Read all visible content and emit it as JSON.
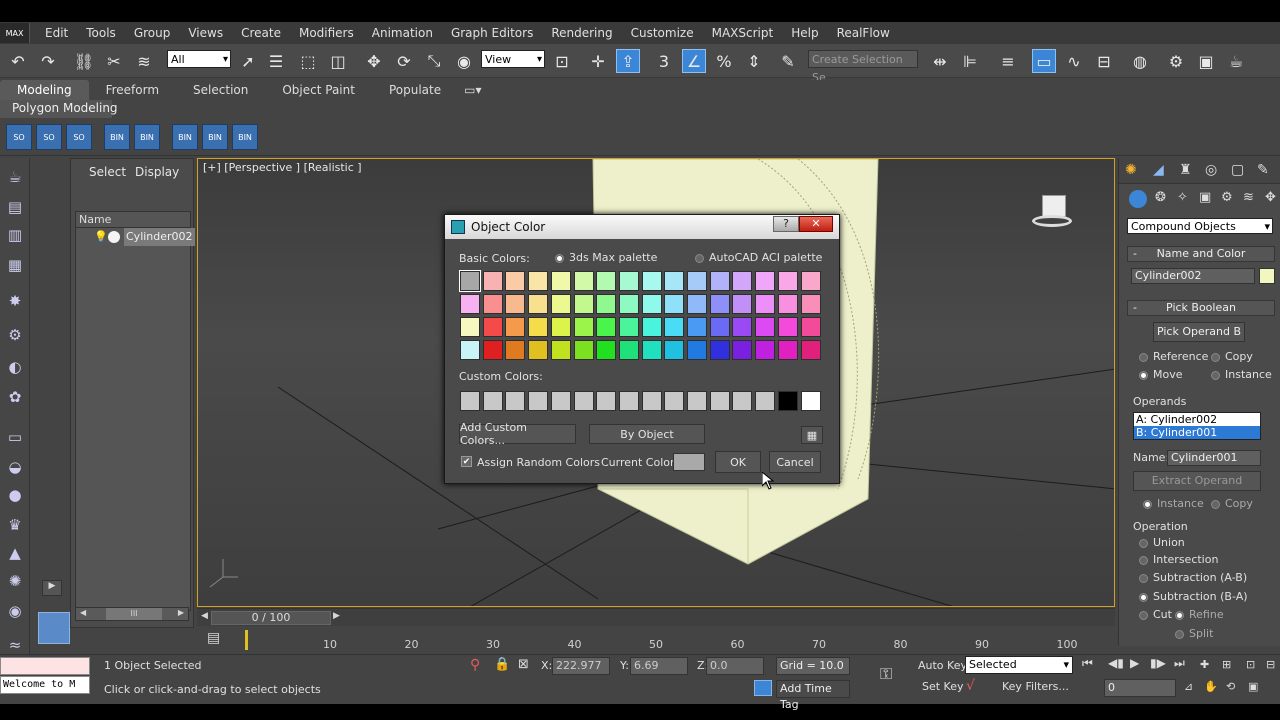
{
  "menubar": {
    "logo": "MAX",
    "items": [
      "Edit",
      "Tools",
      "Group",
      "Views",
      "Create",
      "Modifiers",
      "Animation",
      "Graph Editors",
      "Rendering",
      "Customize",
      "MAXScript",
      "Help",
      "RealFlow"
    ]
  },
  "toolbar": {
    "filter_select": "All",
    "refcoord_select": "View",
    "named_selection_placeholder": "Create Selection Se"
  },
  "ribbon": {
    "tabs": [
      "Modeling",
      "Freeform",
      "Selection",
      "Object Paint",
      "Populate"
    ],
    "active_tab": "Modeling",
    "panel_label": "Polygon Modeling"
  },
  "explorer": {
    "tabs": [
      "Select",
      "Display"
    ],
    "column_header": "Name",
    "rows": [
      "Cylinder002"
    ],
    "scroll_label": "III"
  },
  "viewport": {
    "label": "[+] [Perspective ] [Realistic ]"
  },
  "dialog": {
    "title": "Object Color",
    "help": "?",
    "close": "✕",
    "basic_colors_label": "Basic Colors:",
    "palette_options": [
      "3ds Max palette",
      "AutoCAD ACI palette"
    ],
    "palette_selected": "3ds Max palette",
    "basic_colors": [
      [
        "#a7a7a7",
        "#f9b2b2",
        "#f9cba7",
        "#f9e6a7",
        "#f0f9a7",
        "#d2f9a7",
        "#b2f9b2",
        "#a7f9d2",
        "#a7f9f0",
        "#a7e6f9",
        "#a7cbf9",
        "#b2b2f9",
        "#d2a7f9",
        "#f0a7f9",
        "#f9a7e6",
        "#f9a7cb"
      ],
      [
        "#f7b0f0",
        "#f98f8f",
        "#f9b98f",
        "#f9e08f",
        "#ecf98f",
        "#c2f98f",
        "#8ff98f",
        "#8ff9c2",
        "#8ff9ec",
        "#8fe0f9",
        "#8fb9f9",
        "#8f8ff9",
        "#c28ff9",
        "#ec8ff9",
        "#f98fe0",
        "#f98fb9"
      ],
      [
        "#f7f7c0",
        "#f44a4a",
        "#f49a4a",
        "#f4dc4a",
        "#dcf44a",
        "#9af44a",
        "#4af44a",
        "#4af49a",
        "#4af4dc",
        "#4adcf4",
        "#4a9af4",
        "#6a6af4",
        "#9a4af4",
        "#dc4af4",
        "#f44adc",
        "#f44a9a"
      ],
      [
        "#c8f4f7",
        "#e02020",
        "#e07a20",
        "#e0c020",
        "#c0e020",
        "#7ae020",
        "#20e020",
        "#20e07a",
        "#20e0c0",
        "#20c0e0",
        "#207ae0",
        "#3030e0",
        "#7a20e0",
        "#c020e0",
        "#e020c0",
        "#e0207a"
      ]
    ],
    "custom_colors_label": "Custom Colors:",
    "custom_colors": [
      "#c8c8c8",
      "#c8c8c8",
      "#c8c8c8",
      "#c8c8c8",
      "#c8c8c8",
      "#c8c8c8",
      "#c8c8c8",
      "#c8c8c8",
      "#c8c8c8",
      "#c8c8c8",
      "#c8c8c8",
      "#c8c8c8",
      "#c8c8c8",
      "#c8c8c8",
      "#000000",
      "#ffffff"
    ],
    "add_custom_button": "Add Custom Colors...",
    "by_object_button": "By Object",
    "assign_random_label": "Assign Random Colors",
    "assign_random_checked": true,
    "current_color_label": "Current Color:",
    "current_color": "#a9a9a9",
    "ok_button": "OK",
    "cancel_button": "Cancel"
  },
  "cmdpanel": {
    "category_select": "Compound Objects",
    "name_color_rollout": "Name and Color",
    "object_name": "Cylinder002",
    "object_color": "#f2f7c2",
    "pick_boolean_rollout": "Pick Boolean",
    "pick_operand_button": "Pick Operand B",
    "pick_options": [
      "Reference",
      "Copy",
      "Move",
      "Instance"
    ],
    "pick_selected": "Move",
    "operands_label": "Operands",
    "operands": [
      "A: Cylinder002",
      "B: Cylinder001"
    ],
    "operand_selected": "B: Cylinder001",
    "name_label": "Name:",
    "operand_name": "Cylinder001",
    "extract_button": "Extract Operand",
    "extract_options": [
      "Instance",
      "Copy"
    ],
    "extract_selected": "Instance",
    "operation_label": "Operation",
    "operations": [
      "Union",
      "Intersection",
      "Subtraction (A-B)",
      "Subtraction (B-A)",
      "Cut"
    ],
    "operation_selected": "Subtraction (B-A)",
    "cut_options": [
      "Refine",
      "Split"
    ],
    "cut_selected": "Refine"
  },
  "timeline": {
    "slider_label": "0 / 100",
    "ticks": [
      "10",
      "20",
      "30",
      "40",
      "50",
      "60",
      "70",
      "80",
      "90",
      "100"
    ]
  },
  "status": {
    "maxscript_text": "Welcome to M",
    "selected_count": "1 Object Selected",
    "prompt": "Click or click-and-drag to select objects",
    "x_label": "X:",
    "x_value": "222.977",
    "y_label": "Y:",
    "y_value": "6.69",
    "z_label": "Z:",
    "z_value": "0.0",
    "grid": "Grid = 10.0",
    "add_time_tag": "Add Time Tag",
    "auto_key": "Auto Key",
    "set_key": "Set Key",
    "selected_dropdown": "Selected",
    "key_filters": "Key Filters...",
    "frame_value": "0"
  }
}
